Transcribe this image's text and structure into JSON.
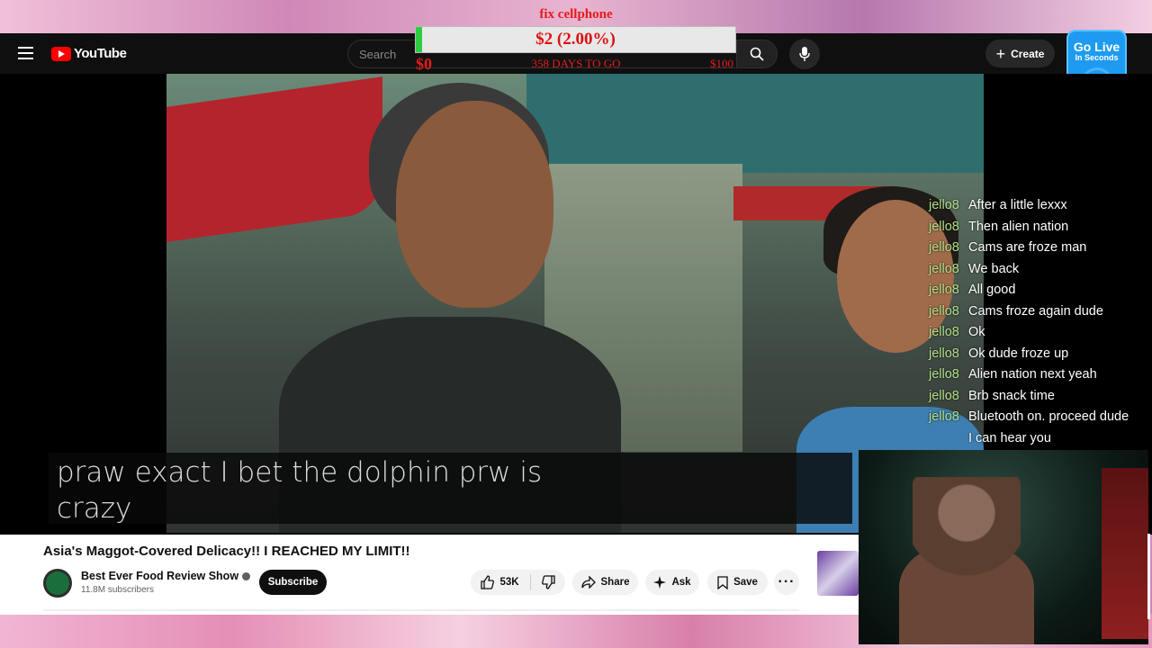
{
  "goal": {
    "title": "fix cellphone",
    "amount_label": "$2 (2.00%)",
    "progress_fraction": 0.02,
    "min_label": "$0",
    "days_label": "358 DAYS TO GO",
    "max_label": "$100"
  },
  "youtube": {
    "logo_text": "YouTube",
    "search_placeholder": "Search",
    "create_label": "Create"
  },
  "golive": {
    "line1": "Go Live",
    "line2": "In Seconds"
  },
  "caption": {
    "text": "praw exact I bet the dolphin prw is crazy"
  },
  "video": {
    "title": "Asia's Maggot-Covered Delicacy!! I REACHED MY LIMIT!!",
    "channel_name": "Best Ever Food Review Show",
    "subscribers": "11.8M subscribers",
    "subscribe_label": "Subscribe",
    "like_count": "53K",
    "share_label": "Share",
    "ask_label": "Ask",
    "save_label": "Save"
  },
  "chat": {
    "messages": [
      {
        "user": "jello8",
        "text": "After a little lexxx"
      },
      {
        "user": "jello8",
        "text": "Then alien nation"
      },
      {
        "user": "jello8",
        "text": "Cams are froze man"
      },
      {
        "user": "jello8",
        "text": "We back"
      },
      {
        "user": "jello8",
        "text": "All good"
      },
      {
        "user": "jello8",
        "text": "Cams froze again dude"
      },
      {
        "user": "jello8",
        "text": "Ok"
      },
      {
        "user": "jello8",
        "text": "Ok dude froze up"
      },
      {
        "user": "jello8",
        "text": "Alien nation next yeah"
      },
      {
        "user": "jello8",
        "text": "Brb snack time"
      },
      {
        "user": "jello8",
        "text": "Bluetooth on. proceed dude"
      }
    ],
    "continuation": "I can hear you"
  },
  "colors": {
    "youtube_red": "#ff0000",
    "goal_red": "#e41b1b",
    "goal_green": "#2ecc40",
    "chat_user": "#b4e08a",
    "golive_blue": "#1e9bf0"
  }
}
